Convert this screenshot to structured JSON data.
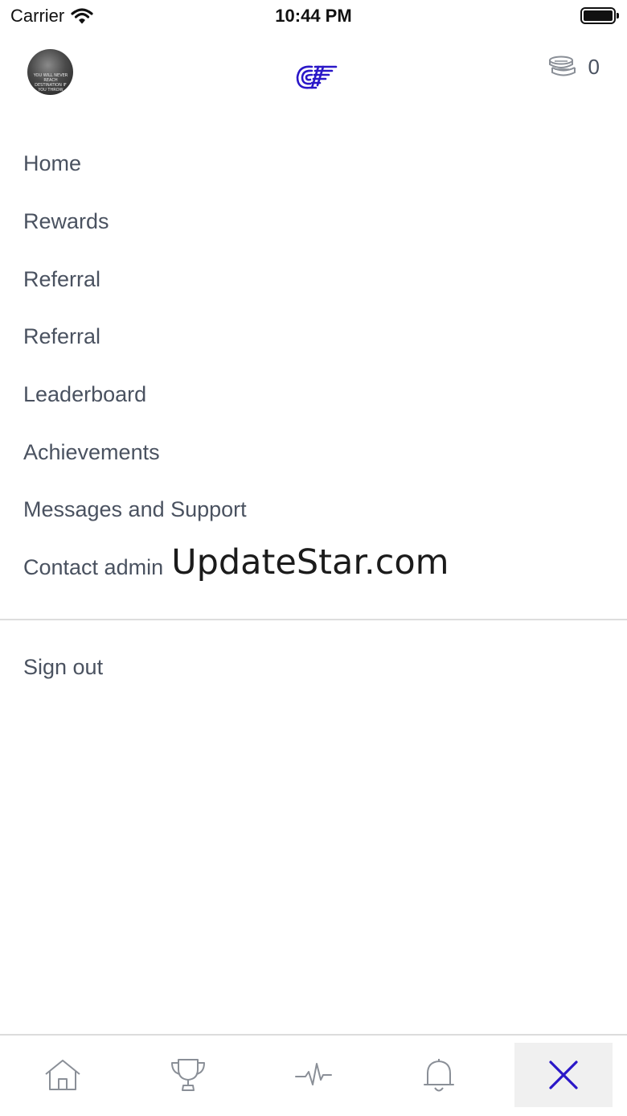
{
  "status_bar": {
    "carrier": "Carrier",
    "time": "10:44 PM"
  },
  "header": {
    "avatar_caption": "YOU WILL NEVER REACH DESTINATION IF YOU THROW",
    "coin_count": "0",
    "brand_color": "#2a17c8"
  },
  "menu": {
    "items": [
      {
        "label": "Home"
      },
      {
        "label": "Rewards"
      },
      {
        "label": "Referral"
      },
      {
        "label": "Referral"
      },
      {
        "label": "Leaderboard"
      },
      {
        "label": "Achievements"
      },
      {
        "label": "Messages and Support"
      },
      {
        "label": "Contact admin"
      }
    ],
    "watermark": "UpdateStar.com",
    "sign_out": "Sign out"
  },
  "bottom_nav": {
    "icons": [
      "home-icon",
      "trophy-icon",
      "activity-icon",
      "bell-icon",
      "close-icon"
    ],
    "active_color": "#2a17c8",
    "icon_color": "#8a8f97"
  }
}
